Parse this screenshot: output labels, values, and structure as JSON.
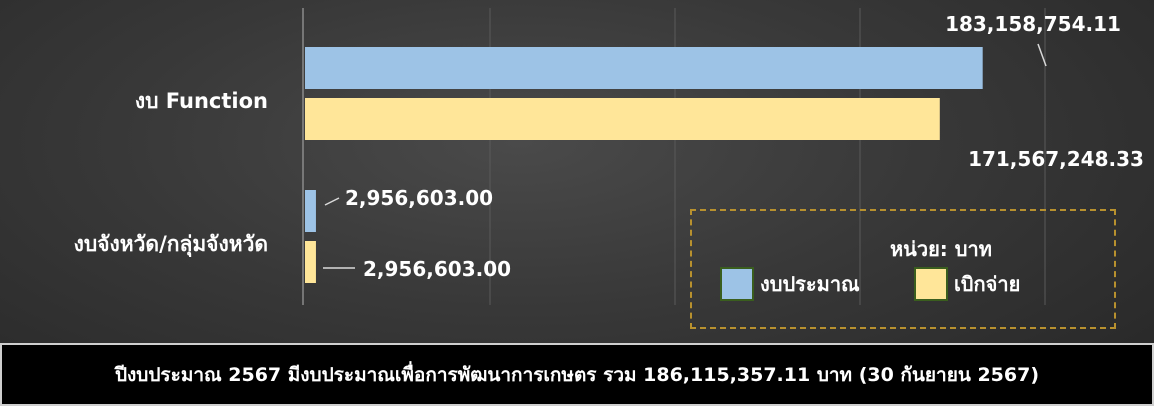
{
  "chart_data": {
    "type": "bar",
    "orientation": "horizontal",
    "categories": [
      "งบ Function",
      "งบจังหวัด/กลุ่มจังหวัด"
    ],
    "series": [
      {
        "name": "งบประมาณ",
        "color": "#9dc3e6",
        "values": [
          183158754.11,
          2956603.0
        ],
        "labels": [
          "183,158,754.11",
          "2,956,603.00"
        ]
      },
      {
        "name": "เบิกจ่าย",
        "color": "#ffe699",
        "values": [
          171567248.33,
          2956603.0
        ],
        "labels": [
          "171,567,248.33",
          "2,956,603.00"
        ]
      }
    ],
    "xlim": [
      0,
      200000000
    ],
    "grid": true,
    "legend_placement": "bottom-right",
    "unit_label": "หน่วย: บาท"
  },
  "footer": {
    "text": "ปีงบประมาณ 2567 มีงบประมาณเพื่อการพัฒนาการเกษตร รวม 186,115,357.11 บาท (30 กันยายน 2567)"
  },
  "colors": {
    "gridline": "#5a5a5a",
    "legend_border": "#b8912e",
    "leader_line": "#d9d9d9"
  }
}
